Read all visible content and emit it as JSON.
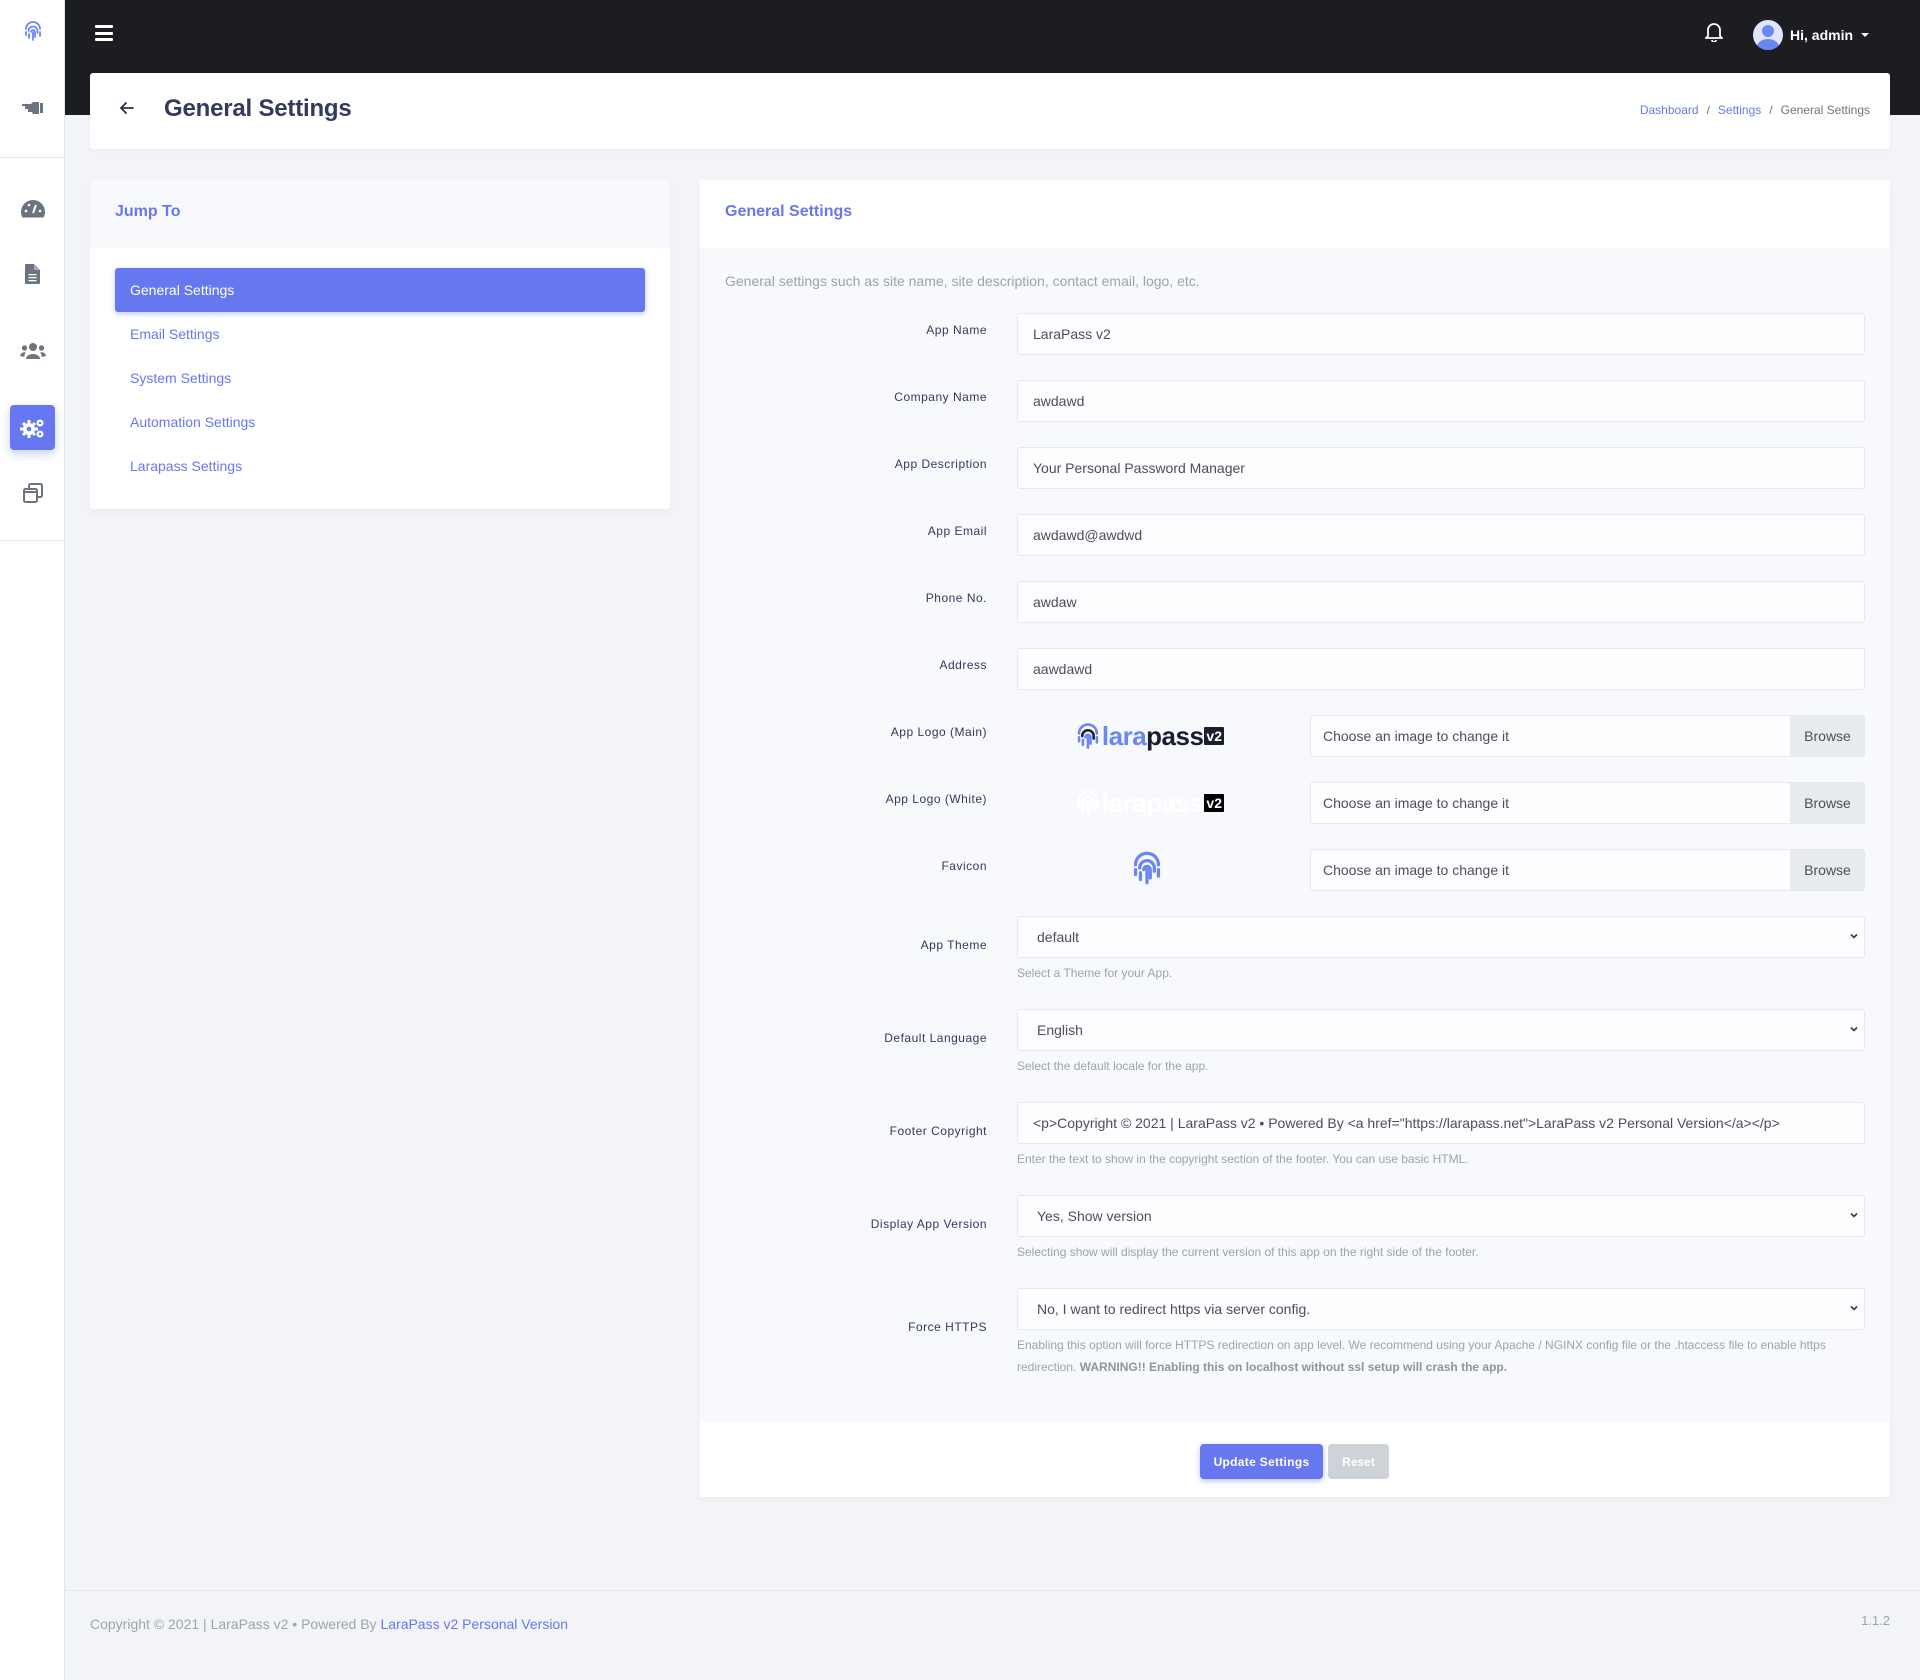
{
  "rail": {
    "items": [
      {
        "icon": "fingerprint-logo-icon",
        "label": "LaraPass"
      },
      {
        "icon": "hand-pointing-icon",
        "label": "Pointer"
      },
      {
        "icon": "tachometer-icon",
        "label": "Dashboard"
      },
      {
        "icon": "file-icon",
        "label": "Documents"
      },
      {
        "icon": "users-icon",
        "label": "Users"
      },
      {
        "icon": "cogs-icon",
        "label": "Settings",
        "active": true
      },
      {
        "icon": "windows-icon",
        "label": "Windows"
      }
    ]
  },
  "navbar": {
    "menu_icon": "hamburger-icon",
    "notification_icon": "bell-icon",
    "user_greeting": "Hi, admin"
  },
  "header": {
    "back_icon": "arrow-left-icon",
    "title": "General Settings",
    "breadcrumb": [
      "Dashboard",
      "Settings",
      "General Settings"
    ]
  },
  "jump_to": {
    "title": "Jump To",
    "items": [
      {
        "label": "General Settings",
        "active": true
      },
      {
        "label": "Email Settings"
      },
      {
        "label": "System Settings"
      },
      {
        "label": "Automation Settings"
      },
      {
        "label": "Larapass Settings"
      }
    ]
  },
  "settings": {
    "title": "General Settings",
    "description": "General settings such as site name, site description, contact email, logo, etc.",
    "fields": {
      "app_name": {
        "label": "App Name",
        "value": "LaraPass v2"
      },
      "company_name": {
        "label": "Company Name",
        "value": "awdawd"
      },
      "app_description": {
        "label": "App Description",
        "value": "Your Personal Password Manager"
      },
      "app_email": {
        "label": "App Email",
        "value": "awdawd@awdwd"
      },
      "phone": {
        "label": "Phone No.",
        "value": "awdaw"
      },
      "address": {
        "label": "Address",
        "value": "aawdawd"
      },
      "logo_main": {
        "label": "App Logo (Main)",
        "logo_text_a": "lara",
        "logo_text_b": "pass",
        "badge": "v2",
        "placeholder": "Choose an image to change it",
        "browse": "Browse"
      },
      "logo_white": {
        "label": "App Logo (White)",
        "logo_text_a": "lara",
        "logo_text_b": "pass",
        "badge": "v2",
        "placeholder": "Choose an image to change it",
        "browse": "Browse"
      },
      "favicon": {
        "label": "Favicon",
        "placeholder": "Choose an image to change it",
        "browse": "Browse"
      },
      "app_theme": {
        "label": "App Theme",
        "value": "default",
        "help": "Select a Theme for your App."
      },
      "default_language": {
        "label": "Default Language",
        "value": "English",
        "help": "Select the default locale for the app."
      },
      "footer_copyright": {
        "label": "Footer Copyright",
        "value": "<p>Copyright © 2021 | LaraPass v2  •  Powered By <a href=\"https://larapass.net\">LaraPass v2 Personal Version</a></p>",
        "help": "Enter the text to show in the copyright section of the footer. You can use basic HTML."
      },
      "display_app_version": {
        "label": "Display App Version",
        "value": "Yes, Show version",
        "help": "Selecting show will display the current version of this app on the right side of the footer."
      },
      "force_https": {
        "label": "Force HTTPS",
        "value": "No, I want to redirect https via server config.",
        "help": "Enabling this option will force HTTPS redirection on app level. We recommend using your Apache / NGINX config file or the .htaccess file to enable https redirection.",
        "warning": "WARNING!! Enabling this on localhost without ssl setup will crash the app."
      }
    },
    "update_button": "Update Settings",
    "reset_button": "Reset"
  },
  "footer": {
    "copyright": "Copyright © 2021 | LaraPass v2 • Powered By",
    "link": "LaraPass v2 Personal Version",
    "version": "1.1.2"
  },
  "colors": {
    "primary": "#6777ef",
    "navbar": "#1c1d21",
    "background": "#f3f4f8"
  }
}
